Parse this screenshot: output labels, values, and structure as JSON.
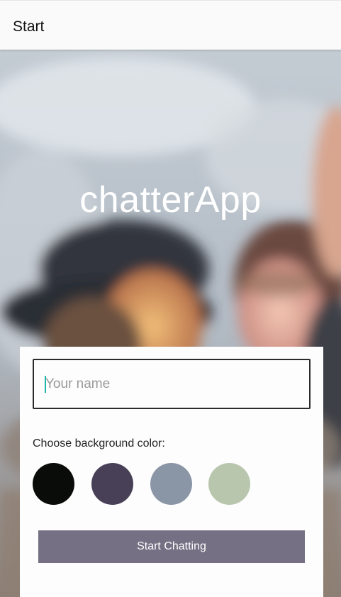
{
  "appbar": {
    "title": "Start"
  },
  "hero": {
    "app_name": "chatterApp",
    "background_image": "people-laughing-photo"
  },
  "form": {
    "name_placeholder": "Your name",
    "name_value": "",
    "color_label": "Choose background color:",
    "colors": [
      "#090C08",
      "#474056",
      "#8A95A5",
      "#B9C6AE"
    ],
    "start_button_label": "Start Chatting",
    "button_color": "#757083"
  }
}
